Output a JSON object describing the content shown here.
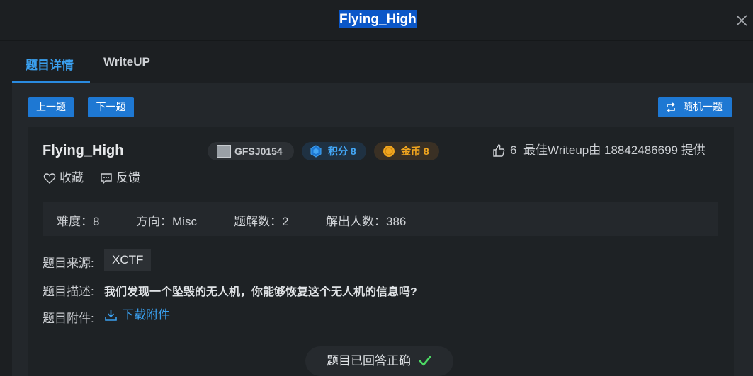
{
  "window": {
    "title": "Flying_High"
  },
  "tabs": [
    {
      "label": "题目详情",
      "active": true
    },
    {
      "label": "WriteUP",
      "active": false
    }
  ],
  "nav": {
    "prev": "上一题",
    "next": "下一题",
    "random": "随机一题"
  },
  "challenge": {
    "name": "Flying_High",
    "author": "GFSJ0154",
    "score": "积分 8",
    "coins": "金币 8",
    "likes": "6",
    "best_writeup": "最佳Writeup由 18842486699 提供",
    "favorite": "收藏",
    "feedback": "反馈"
  },
  "stats": {
    "difficulty": "难度：8",
    "direction": "方向：Misc",
    "solves": "题解数：2",
    "solvers": "解出人数：386"
  },
  "details": {
    "source_label": "题目来源:",
    "source": "XCTF",
    "desc_label": "题目描述:",
    "desc": "我们发现一个坠毁的无人机，你能够恢复这个无人机的信息吗?",
    "attach_label": "题目附件:",
    "attach": "下载附件"
  },
  "status": {
    "solved": "题目已回答正确"
  },
  "colors": {
    "accent": "#1e78d3",
    "link": "#3a9fee",
    "score": "#43a6f5",
    "coin": "#f0a51f",
    "success": "#4cd964"
  }
}
